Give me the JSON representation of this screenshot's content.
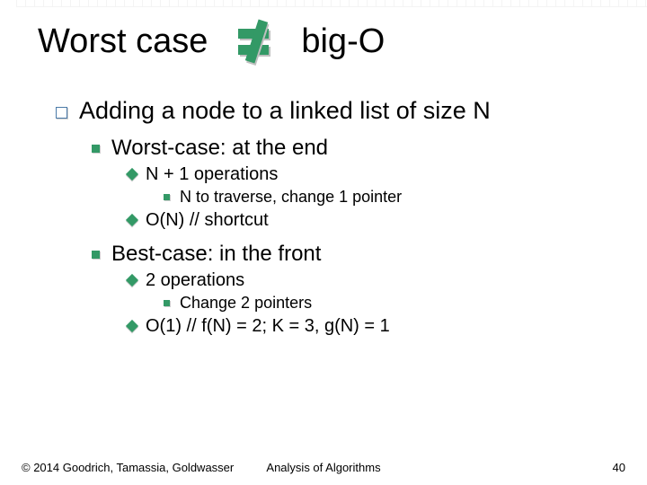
{
  "title": {
    "left": "Worst case",
    "right": "big-O",
    "icon": "not-equal"
  },
  "body": {
    "lvl1": "Adding a node to a linked list of size N",
    "group1": {
      "lvl2": "Worst-case: at the end",
      "lvl3a": "N + 1 operations",
      "lvl4a": "N to traverse, change 1 pointer",
      "lvl3b": "O(N)  // shortcut"
    },
    "group2": {
      "lvl2": "Best-case: in the front",
      "lvl3a": "2 operations",
      "lvl4a": "Change 2 pointers",
      "lvl3b": "O(1)   // f(N) = 2; K = 3, g(N) = 1"
    }
  },
  "footer": {
    "copyright": "© 2014 Goodrich, Tamassia, Goldwasser",
    "center": "Analysis of Algorithms",
    "page": "40"
  }
}
